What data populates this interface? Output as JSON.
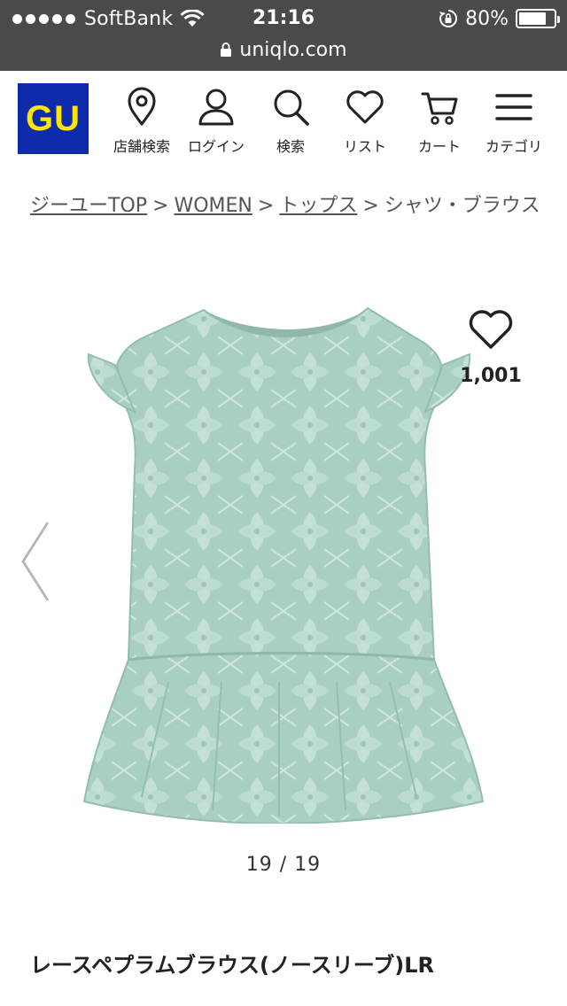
{
  "status_bar": {
    "carrier": "SoftBank",
    "time": "21:16",
    "battery_percent_text": "80%",
    "battery_level": 0.8,
    "url": "uniqlo.com"
  },
  "header": {
    "logo_text": "GU",
    "brand_color": "#0d2bab",
    "logo_text_color": "#ffe600",
    "nav": [
      {
        "label": "店舗検索",
        "icon": "map-pin-icon"
      },
      {
        "label": "ログイン",
        "icon": "user-icon"
      },
      {
        "label": "検索",
        "icon": "search-icon"
      },
      {
        "label": "リスト",
        "icon": "heart-icon"
      },
      {
        "label": "カート",
        "icon": "cart-icon"
      },
      {
        "label": "カテゴリ",
        "icon": "menu-icon"
      }
    ]
  },
  "breadcrumb": {
    "items": [
      {
        "label": "ジーユーTOP",
        "link": true
      },
      {
        "label": "WOMEN",
        "link": true
      },
      {
        "label": "トップス",
        "link": true
      },
      {
        "label": "シャツ・ブラウス",
        "link": false
      }
    ],
    "separator": ">"
  },
  "product": {
    "favorite_count": "1,001",
    "pager": "19 / 19",
    "name": "レースペプラムブラウス(ノースリーブ)LR",
    "image_color": "#a9cfc4"
  }
}
